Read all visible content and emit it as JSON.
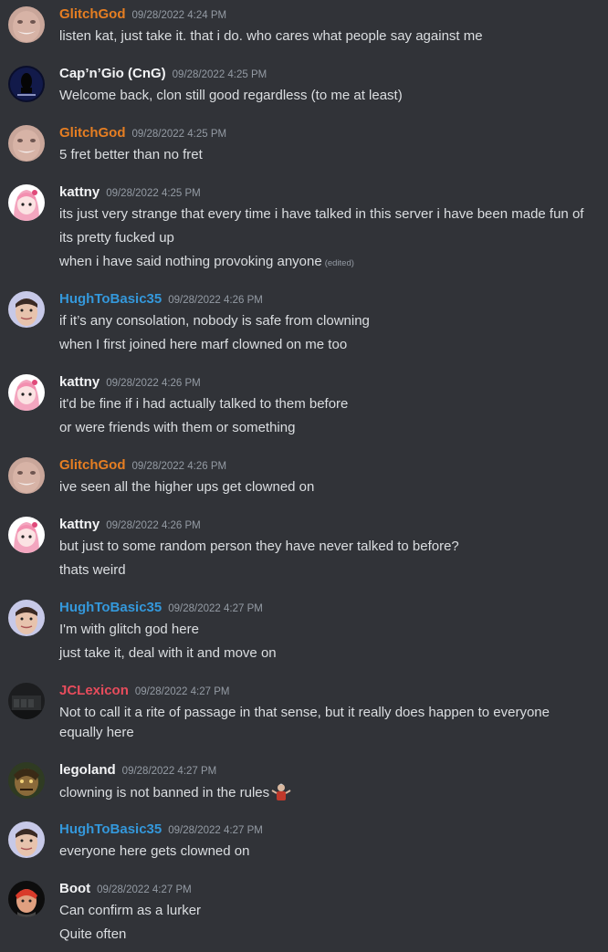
{
  "colors": {
    "background": "#313338",
    "text": "#dbdee1",
    "timestamp": "#949ba4",
    "orange_role": "#e67e22",
    "blue_role": "#3498db",
    "red_role": "#e74c5c",
    "white_role": "#f2f3f5"
  },
  "messages": [
    {
      "author": "GlitchGod",
      "author_color": "#e67e22",
      "avatar_icon": "glitchgod-avatar-icon",
      "timestamp": "09/28/2022 4:24 PM",
      "lines": [
        "listen kat, just take it. that i do. who cares what people say against me"
      ]
    },
    {
      "author": "Cap’n’Gio (CnG)",
      "author_color": "#f2f3f5",
      "avatar_icon": "capngio-avatar-icon",
      "timestamp": "09/28/2022 4:25 PM",
      "lines": [
        "Welcome back, clon still good regardless (to me at least)"
      ]
    },
    {
      "author": "GlitchGod",
      "author_color": "#e67e22",
      "avatar_icon": "glitchgod-avatar-icon",
      "timestamp": "09/28/2022 4:25 PM",
      "lines": [
        "5 fret better than no fret"
      ]
    },
    {
      "author": "kattny",
      "author_color": "#f2f3f5",
      "avatar_icon": "kattny-avatar-icon",
      "timestamp": "09/28/2022 4:25 PM",
      "lines": [
        "its just very strange that every time i have talked in this server i have been made fun of",
        "its pretty fucked up",
        "when i have said nothing provoking anyone"
      ],
      "edited_label": "(edited)"
    },
    {
      "author": "HughToBasic35",
      "author_color": "#3498db",
      "avatar_icon": "hugh-avatar-icon",
      "timestamp": "09/28/2022 4:26 PM",
      "lines": [
        "if it’s any consolation, nobody is safe from clowning",
        "when I first joined here marf clowned on me too"
      ]
    },
    {
      "author": "kattny",
      "author_color": "#f2f3f5",
      "avatar_icon": "kattny-avatar-icon",
      "timestamp": "09/28/2022 4:26 PM",
      "lines": [
        "it'd be fine if i had actually talked to them before",
        "or were friends with them or something"
      ]
    },
    {
      "author": "GlitchGod",
      "author_color": "#e67e22",
      "avatar_icon": "glitchgod-avatar-icon",
      "timestamp": "09/28/2022 4:26 PM",
      "lines": [
        "ive seen all the higher ups get clowned on"
      ]
    },
    {
      "author": "kattny",
      "author_color": "#f2f3f5",
      "avatar_icon": "kattny-avatar-icon",
      "timestamp": "09/28/2022 4:26 PM",
      "lines": [
        "but just to some random person they have never talked to before?",
        "thats weird"
      ]
    },
    {
      "author": "HughToBasic35",
      "author_color": "#3498db",
      "avatar_icon": "hugh-avatar-icon",
      "timestamp": "09/28/2022 4:27 PM",
      "lines": [
        "I'm with glitch god here",
        "just take it, deal with it and move on"
      ]
    },
    {
      "author": "JCLexicon",
      "author_color": "#e74c5c",
      "avatar_icon": "jclexicon-avatar-icon",
      "timestamp": "09/28/2022 4:27 PM",
      "lines": [
        "Not to call it a rite of passage in that sense, but it really does happen to everyone equally here"
      ]
    },
    {
      "author": "legoland",
      "author_color": "#f2f3f5",
      "avatar_icon": "legoland-avatar-icon",
      "timestamp": "09/28/2022 4:27 PM",
      "lines": [
        "clowning is not banned in the rules"
      ],
      "emoji_icon": "shrug-person-emoji-icon"
    },
    {
      "author": "HughToBasic35",
      "author_color": "#3498db",
      "avatar_icon": "hugh-avatar-icon",
      "timestamp": "09/28/2022 4:27 PM",
      "lines": [
        "everyone here gets clowned on"
      ]
    },
    {
      "author": "Boot",
      "author_color": "#f2f3f5",
      "avatar_icon": "boot-avatar-icon",
      "timestamp": "09/28/2022 4:27 PM",
      "lines": [
        "Can confirm as a lurker",
        "Quite often"
      ]
    }
  ]
}
